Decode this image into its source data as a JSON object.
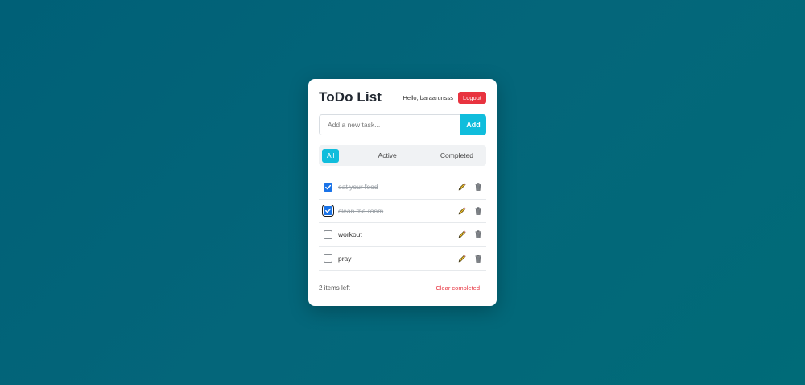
{
  "app": {
    "title": "ToDo List",
    "greeting": "Hello, baraarunsss",
    "logout_label": "Logout"
  },
  "add": {
    "placeholder": "Add a new task...",
    "button_label": "Add"
  },
  "filters": [
    {
      "label": "All",
      "active": true
    },
    {
      "label": "Active",
      "active": false
    },
    {
      "label": "Completed",
      "active": false
    }
  ],
  "todos": [
    {
      "text": "eat your food",
      "completed": true,
      "edit_icon": "pencil-icon",
      "delete_icon": "trash-icon"
    },
    {
      "text": "clean the room",
      "completed": true,
      "edit_icon": "pencil-icon",
      "delete_icon": "trash-icon"
    },
    {
      "text": "workout",
      "completed": false,
      "edit_icon": "pencil-icon",
      "delete_icon": "trash-icon"
    },
    {
      "text": "pray",
      "completed": false,
      "edit_icon": "pencil-icon",
      "delete_icon": "trash-icon"
    }
  ],
  "footer": {
    "items_left": "2 items left",
    "clear_label": "Clear completed"
  },
  "colors": {
    "accent": "#10bddc",
    "danger": "#e8333f",
    "checkbox_checked": "#1a73e8",
    "background": "#006077"
  }
}
